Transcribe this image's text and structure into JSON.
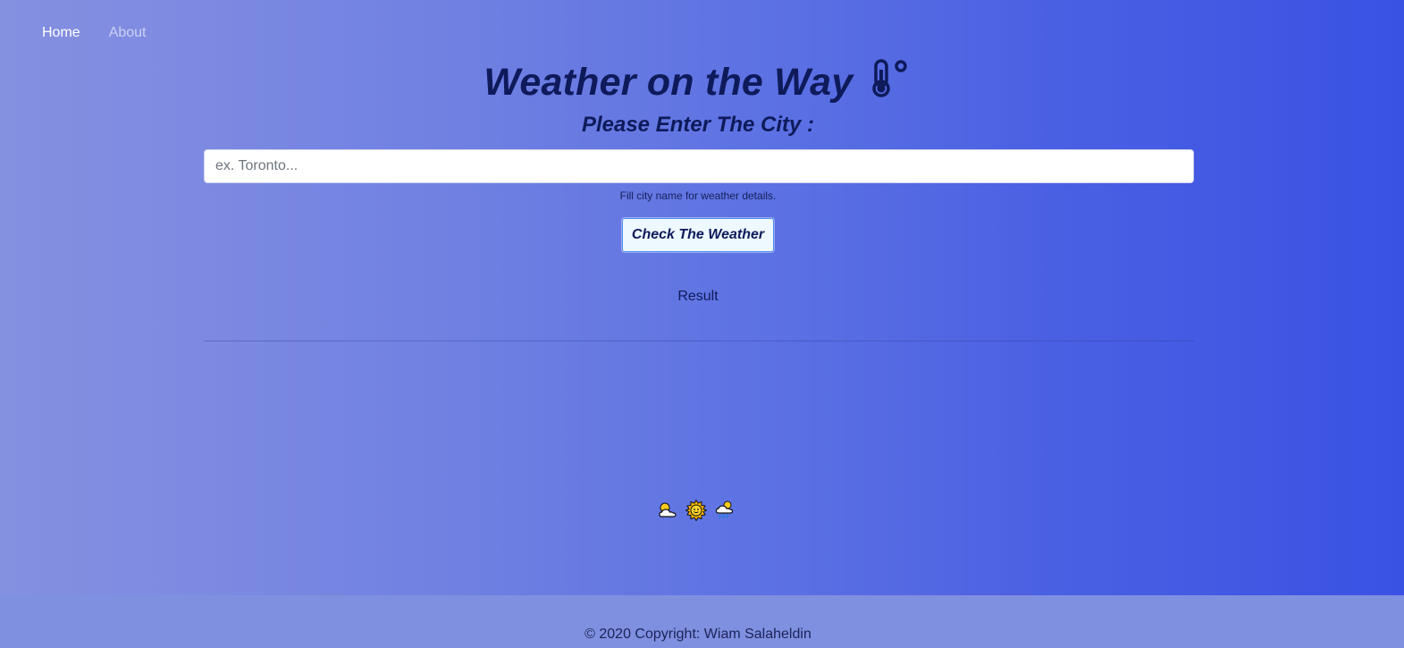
{
  "nav": {
    "items": [
      {
        "label": "Home"
      },
      {
        "label": "About"
      }
    ]
  },
  "header": {
    "title": "Weather on the Way",
    "title_icon": "thermometer-icon",
    "subtitle": "Please Enter The City :"
  },
  "search": {
    "placeholder": "ex. Toronto...",
    "value": "",
    "hint": "Fill city name for weather details."
  },
  "actions": {
    "check_label": "Check The Weather"
  },
  "result": {
    "label": "Result"
  },
  "decor": {
    "icons": [
      "sun-behind-cloud-icon",
      "sun-icon",
      "cloud-with-rain-icon"
    ]
  },
  "footer": {
    "copyright": "© 2020 Copyright: Wiam Salaheldin"
  },
  "colors": {
    "title": "#0e1a5a",
    "button_bg": "#eef8ff",
    "button_border": "#4a8ff0",
    "gradient_start": "#8490e0",
    "gradient_end": "#3a52e3",
    "footer_bg": "#8090e0"
  }
}
